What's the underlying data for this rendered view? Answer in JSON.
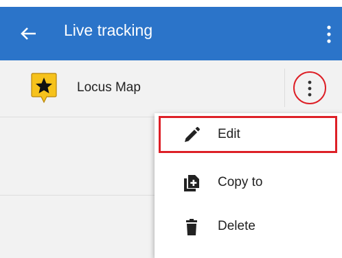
{
  "appbar": {
    "title": "Live tracking",
    "background_color": "#2b74c9",
    "back_icon": "arrow-left-icon",
    "overflow_icon": "more-vert-icon"
  },
  "list": {
    "items": [
      {
        "label": "Locus Map",
        "icon": "star-marker-icon",
        "icon_color": "#f6c21c"
      }
    ]
  },
  "context_menu": {
    "items": [
      {
        "label": "Edit",
        "icon": "pencil-icon",
        "highlighted": true
      },
      {
        "label": "Copy to",
        "icon": "copy-add-icon"
      },
      {
        "label": "Delete",
        "icon": "trash-icon"
      }
    ]
  },
  "annotation_color": "#dd1f26"
}
